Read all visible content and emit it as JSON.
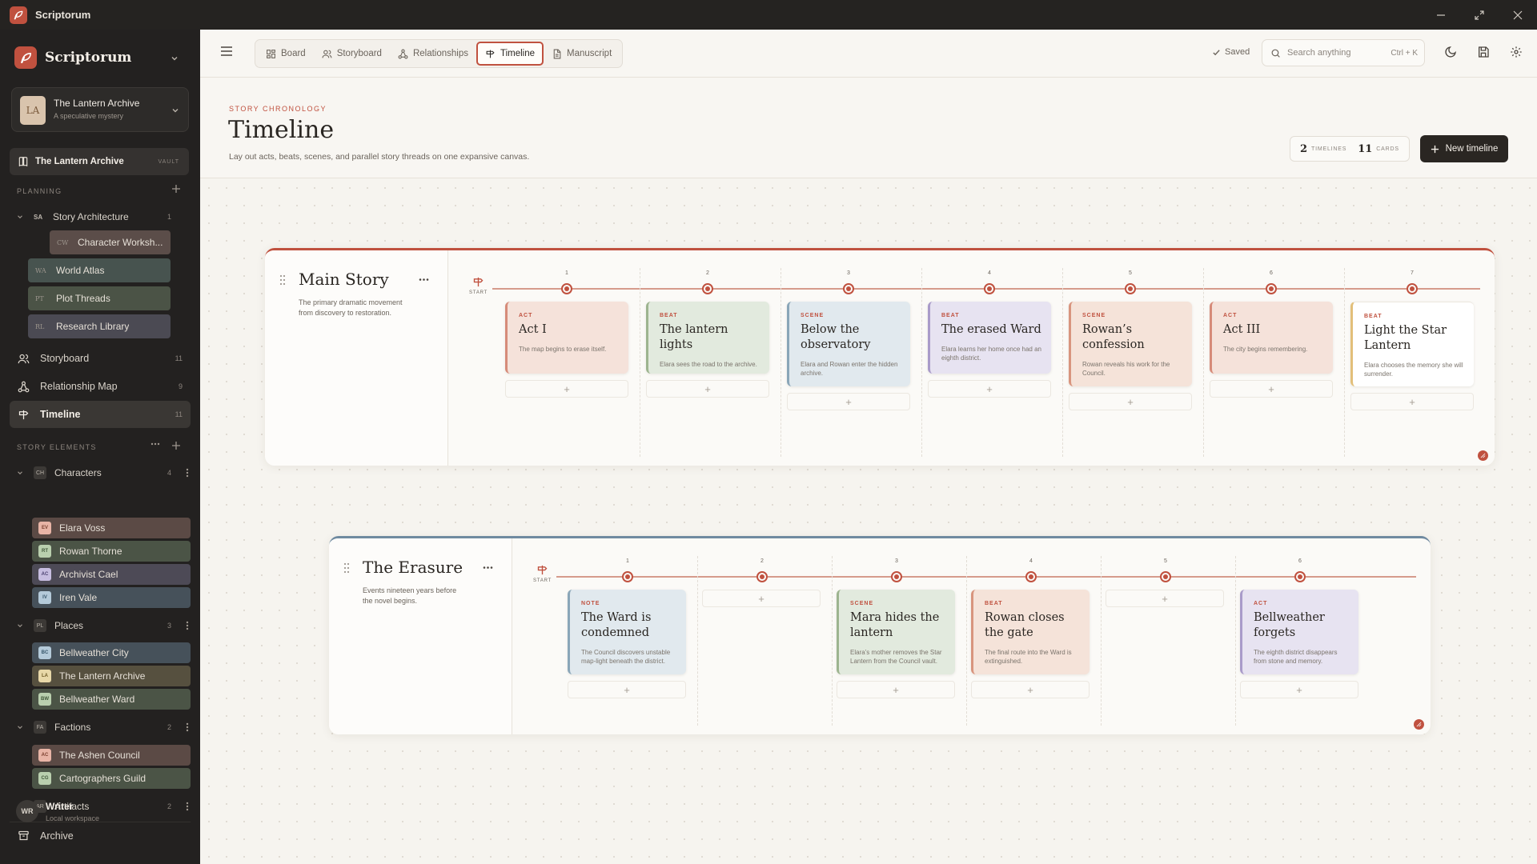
{
  "app": {
    "title": "Scriptorum",
    "brand": "Scriptorum"
  },
  "project": {
    "avatar": "LA",
    "name": "The Lantern Archive",
    "subtitle": "A speculative mystery"
  },
  "vault": {
    "label": "The Lantern Archive",
    "tag": "VAULT"
  },
  "planning": {
    "section": "PLANNING",
    "group": {
      "abbr": "SA",
      "label": "Story Architecture",
      "count": "1"
    },
    "items": [
      {
        "abbr": "CW",
        "label": "Character Worksh...",
        "color": "#5b4d49"
      },
      {
        "abbr": "WA",
        "label": "World Atlas",
        "color": "#47534f"
      },
      {
        "abbr": "PT",
        "label": "Plot Threads",
        "color": "#4b5346"
      },
      {
        "abbr": "RL",
        "label": "Research Library",
        "color": "#4b4a53"
      }
    ]
  },
  "nav": {
    "storyboard": {
      "label": "Storyboard",
      "count": "11"
    },
    "relationship": {
      "label": "Relationship Map",
      "count": "9"
    },
    "timeline": {
      "label": "Timeline",
      "count": "11"
    }
  },
  "elements": {
    "section": "STORY ELEMENTS",
    "characters": {
      "abbr": "CH",
      "label": "Characters",
      "count": "4",
      "items": [
        {
          "abbr": "EV",
          "label": "Elara Voss",
          "color": "#5b4a45",
          "badge": "#e8b4a6"
        },
        {
          "abbr": "RT",
          "label": "Rowan Thorne",
          "color": "#4b5446",
          "badge": "#b9cfae"
        },
        {
          "abbr": "AC",
          "label": "Archivist Cael",
          "color": "#4d4a56",
          "badge": "#c7bde0"
        },
        {
          "abbr": "IV",
          "label": "Iren Vale",
          "color": "#46515a",
          "badge": "#b4cad9"
        }
      ]
    },
    "places": {
      "abbr": "PL",
      "label": "Places",
      "count": "3",
      "items": [
        {
          "abbr": "BC",
          "label": "Bellweather City",
          "color": "#46515a",
          "badge": "#b4cad9"
        },
        {
          "abbr": "LA",
          "label": "The Lantern Archive",
          "color": "#56503f",
          "badge": "#e8d8a8"
        },
        {
          "abbr": "BW",
          "label": "Bellweather Ward",
          "color": "#4b5446",
          "badge": "#b9cfae"
        }
      ]
    },
    "factions": {
      "abbr": "FA",
      "label": "Factions",
      "count": "2",
      "items": [
        {
          "abbr": "AC",
          "label": "The Ashen Council",
          "color": "#5b4a45",
          "badge": "#e8b4a6"
        },
        {
          "abbr": "CG",
          "label": "Cartographers Guild",
          "color": "#4b5446",
          "badge": "#b9cfae"
        }
      ]
    },
    "artifacts": {
      "abbr": "AR",
      "label": "Artifacts",
      "count": "2"
    }
  },
  "archive": {
    "label": "Archive"
  },
  "user": {
    "avatar": "WR",
    "name": "Writer",
    "subtitle": "Local workspace"
  },
  "toolbar": {
    "tabs": [
      {
        "label": "Board",
        "icon": "board-icon"
      },
      {
        "label": "Storyboard",
        "icon": "storyboard-icon"
      },
      {
        "label": "Relationships",
        "icon": "relationships-icon"
      },
      {
        "label": "Timeline",
        "icon": "signpost-icon",
        "active": true
      },
      {
        "label": "Manuscript",
        "icon": "document-icon"
      }
    ],
    "saved": "Saved",
    "search_placeholder": "Search anything",
    "search_hint": "Ctrl + K"
  },
  "header": {
    "eyebrow": "STORY CHRONOLOGY",
    "title": "Timeline",
    "subtitle": "Lay out acts, beats, scenes, and parallel story threads on one expansive canvas.",
    "timelines_count": "2",
    "timelines_label": "TIMELINES",
    "cards_count": "11",
    "cards_label": "CARDS",
    "new_button": "New timeline"
  },
  "timelines": [
    {
      "name": "Main Story",
      "description": "The primary dramatic movement from discovery to restoration.",
      "start_label": "START",
      "accent": "#c0513f",
      "columns": [
        {
          "num": "1",
          "card": {
            "type": "ACT",
            "title": "Act I",
            "desc": "The map begins to erase itself.",
            "bg": "#f5e2da",
            "border": "#d68b79"
          }
        },
        {
          "num": "2",
          "card": {
            "type": "BEAT",
            "title": "The lantern lights",
            "desc": "Elara sees the road to the archive.",
            "bg": "#e2eade",
            "border": "#9db48f"
          }
        },
        {
          "num": "3",
          "card": {
            "type": "SCENE",
            "title": "Below the observatory",
            "desc": "Elara and Rowan enter the hidden archive.",
            "bg": "#e1e9ee",
            "border": "#8aa6b8"
          }
        },
        {
          "num": "4",
          "card": {
            "type": "BEAT",
            "title": "The erased Ward",
            "desc": "Elara learns her home once had an eighth district.",
            "bg": "#e7e3f1",
            "border": "#a99bc9"
          }
        },
        {
          "num": "5",
          "card": {
            "type": "SCENE",
            "title": "Rowan’s confession",
            "desc": "Rowan reveals his work for the Council.",
            "bg": "#f5e3d9",
            "border": "#d8957e"
          }
        },
        {
          "num": "6",
          "card": {
            "type": "ACT",
            "title": "Act III",
            "desc": "The city begins remembering.",
            "bg": "#f5e2da",
            "border": "#d68b79"
          }
        },
        {
          "num": "7",
          "card": {
            "type": "BEAT",
            "title": "Light the Star Lantern",
            "desc": "Elara chooses the memory she will surrender.",
            "bg": "#ffffff",
            "border": "#e2bf7a"
          }
        }
      ]
    },
    {
      "name": "The Erasure",
      "description": "Events nineteen years before the novel begins.",
      "start_label": "START",
      "accent": "#6f8aa0",
      "columns": [
        {
          "num": "1",
          "card": {
            "type": "NOTE",
            "title": "The Ward is condemned",
            "desc": "The Council discovers unstable map-light beneath the district.",
            "bg": "#e1e9ee",
            "border": "#8aa6b8"
          }
        },
        {
          "num": "2",
          "card": null
        },
        {
          "num": "3",
          "card": {
            "type": "SCENE",
            "title": "Mara hides the lantern",
            "desc": "Elara’s mother removes the Star Lantern from the Council vault.",
            "bg": "#e2eade",
            "border": "#9db48f"
          }
        },
        {
          "num": "4",
          "card": {
            "type": "BEAT",
            "title": "Rowan closes the gate",
            "desc": "The final route into the Ward is extinguished.",
            "bg": "#f5e3d9",
            "border": "#d8957e"
          }
        },
        {
          "num": "5",
          "card": null
        },
        {
          "num": "6",
          "card": {
            "type": "ACT",
            "title": "Bellweather forgets",
            "desc": "The eighth district disappears from stone and memory.",
            "bg": "#e7e3f1",
            "border": "#a99bc9"
          }
        }
      ]
    }
  ]
}
